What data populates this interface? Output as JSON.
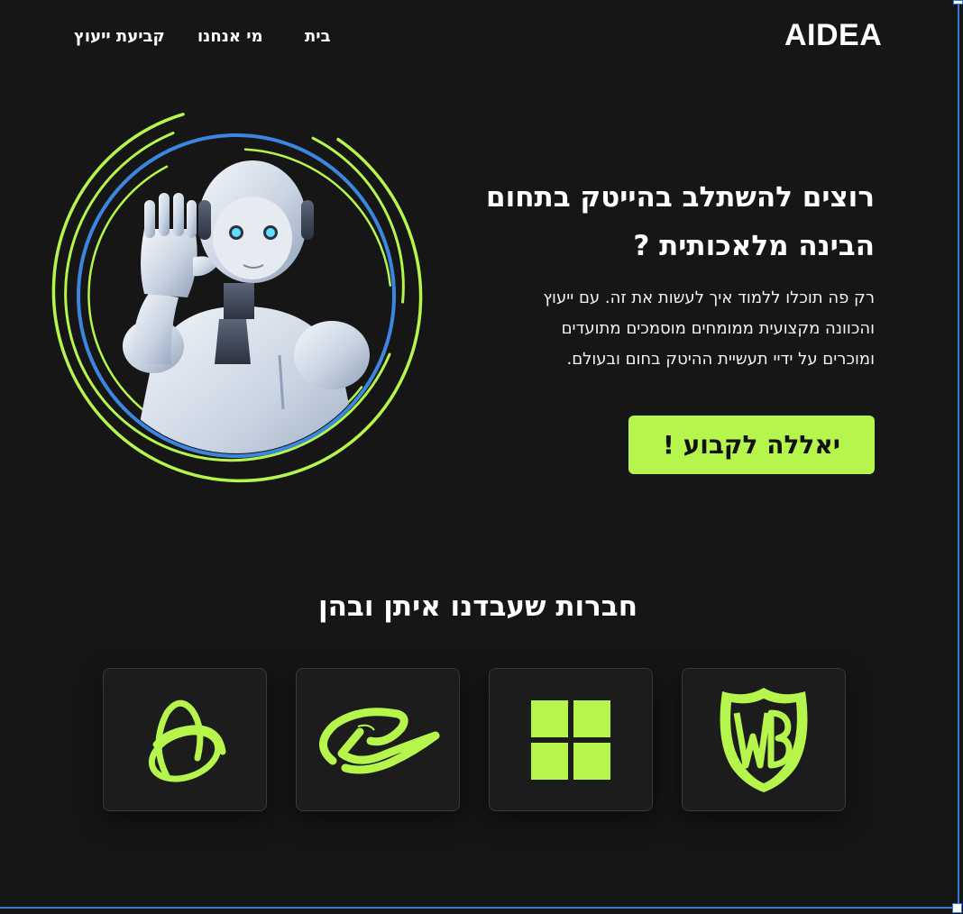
{
  "header": {
    "brand": "AIDEA",
    "nav": {
      "home": "בית",
      "about": "מי אנחנו",
      "book": "קביעת ייעוץ"
    }
  },
  "hero": {
    "title_line1": "רוצים להשתלב בהייטק בתחום",
    "title_line2": "הבינה מלאכותית ?",
    "desc_line1": "רק פה תוכלו ללמוד איך לעשות את זה. עם ייעוץ",
    "desc_line2": "והכוונה מקצועית ממומחים מוסמכים מתועדים",
    "desc_line3": "ומוכרים על ידיי תעשיית ההיטק בחום ובעולם.",
    "cta": "יאללה לקבוע !"
  },
  "companies": {
    "title": "חברות שעבדנו איתן ובהן",
    "logos": [
      "atom-orbit-logo-icon",
      "alibaba-logo-icon",
      "windows-logo-icon",
      "warner-bros-logo-icon"
    ]
  },
  "colors": {
    "background": "#161616",
    "accent": "#b6f64c",
    "frame": "#2f7bd6"
  }
}
